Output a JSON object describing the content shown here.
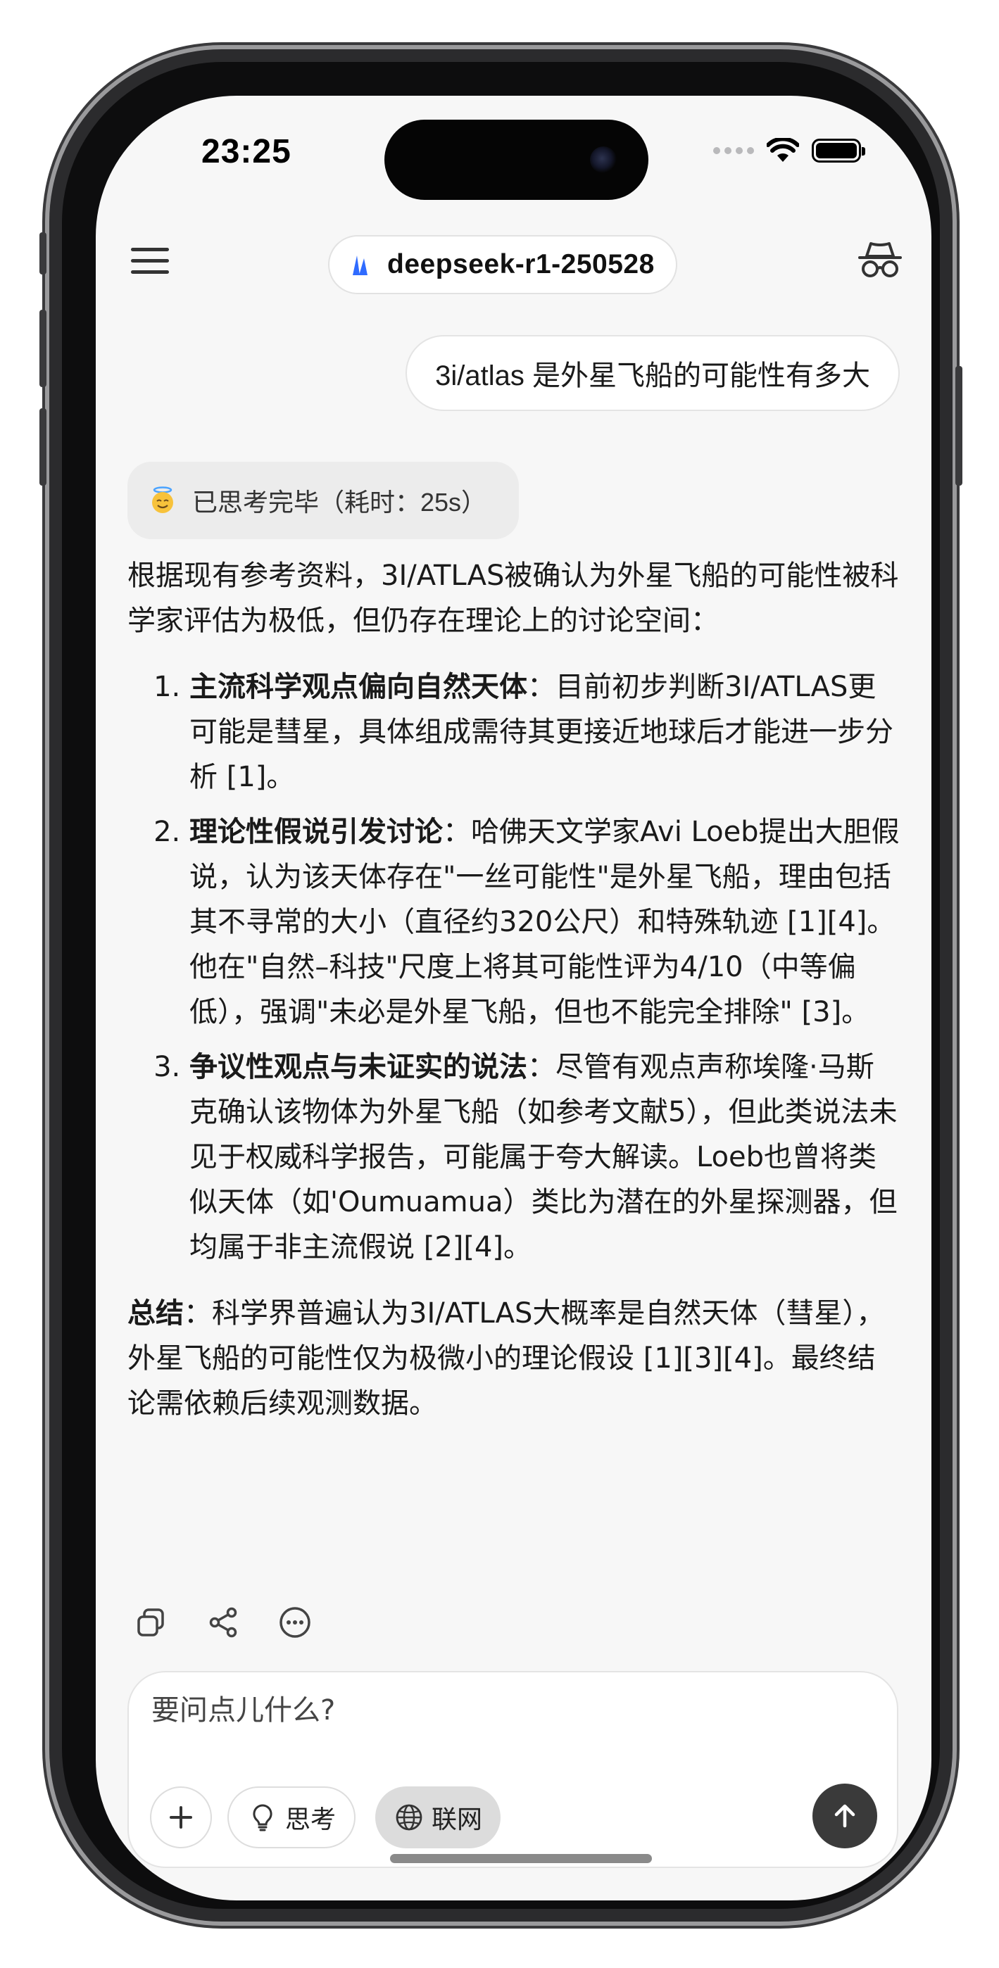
{
  "status_bar": {
    "time": "23:25"
  },
  "header": {
    "model_name": "deepseek-r1-250528"
  },
  "conversation": {
    "user_message": "3i/atlas 是外星飞船的可能性有多大",
    "thinking_status": "已思考完毕（耗时：25s）",
    "answer": {
      "intro": "根据现有参考资料，3I/ATLAS被确认为外星飞船的可能性被科学家评估为极低，但仍存在理论上的讨论空间：",
      "points": [
        {
          "title": "主流科学观点偏向自然天体",
          "text": "：目前初步判断3I/ATLAS更可能是彗星，具体组成需待其更接近地球后才能进一步分析 [1]。"
        },
        {
          "title": "理论性假说引发讨论",
          "text": "：哈佛天文学家Avi Loeb提出大胆假说，认为该天体存在\"一丝可能性\"是外星飞船，理由包括其不寻常的大小（直径约320公尺）和特殊轨迹 [1][4]。他在\"自然–科技\"尺度上将其可能性评为4/10（中等偏低），强调\"未必是外星飞船，但也不能完全排除\" [3]。"
        },
        {
          "title": "争议性观点与未证实的说法",
          "text": "：尽管有观点声称埃隆·马斯克确认该物体为外星飞船（如参考文献5），但此类说法未见于权威科学报告，可能属于夸大解读。Loeb也曾将类似天体（如'Oumuamua）类比为潜在的外星探测器，但均属于非主流假说 [2][4]。"
        }
      ],
      "summary_label": "总结",
      "summary_text": "：科学界普遍认为3I/ATLAS大概率是自然天体（彗星），外星飞船的可能性仅为极微小的理论假设 [1][3][4]。最终结论需依赖后续观测数据。"
    }
  },
  "composer": {
    "placeholder": "要问点儿什么?",
    "think_label": "思考",
    "web_label": "联网"
  },
  "colors": {
    "accent_blue": "#2f6bff",
    "send_button": "#3a3a3a"
  }
}
